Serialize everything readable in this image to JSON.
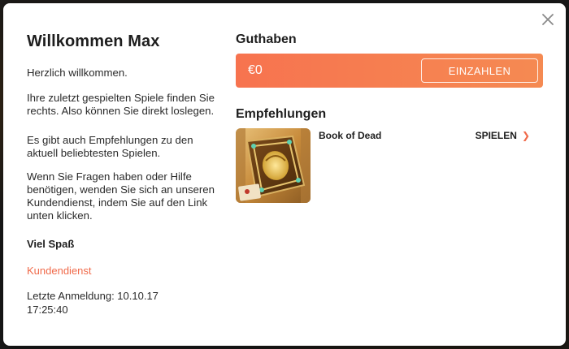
{
  "modal": {
    "close_icon": "close-icon"
  },
  "left": {
    "title": "Willkommen Max",
    "welcome": "Herzlich willkommen.",
    "intro": "Ihre zuletzt gespielten Spiele finden Sie rechts. Also können Sie direkt loslegen.",
    "intro2": "Es gibt auch Empfehlungen zu den aktuell beliebtesten Spielen.",
    "help": "Wenn Sie Fragen haben oder Hilfe benötigen, wenden Sie sich an unseren Kundendienst, indem Sie auf den Link unten klicken.",
    "fun": "Viel Spaß",
    "support_link": "Kundendienst",
    "last_login": "Letzte Anmeldung: 10.10.17 17:25:40"
  },
  "right": {
    "balance_title": "Guthaben",
    "balance_amount": "€0",
    "deposit_label": "EINZAHLEN",
    "recommendations_title": "Empfehlungen",
    "recommendations": [
      {
        "name": "Book of Dead",
        "play_label": "SPIELEN",
        "chevron_icon": "chevron-right-icon"
      }
    ]
  },
  "colors": {
    "accent": "#f06a4a",
    "balance_gradient_start": "#f7734f",
    "balance_gradient_end": "#f58a52"
  }
}
